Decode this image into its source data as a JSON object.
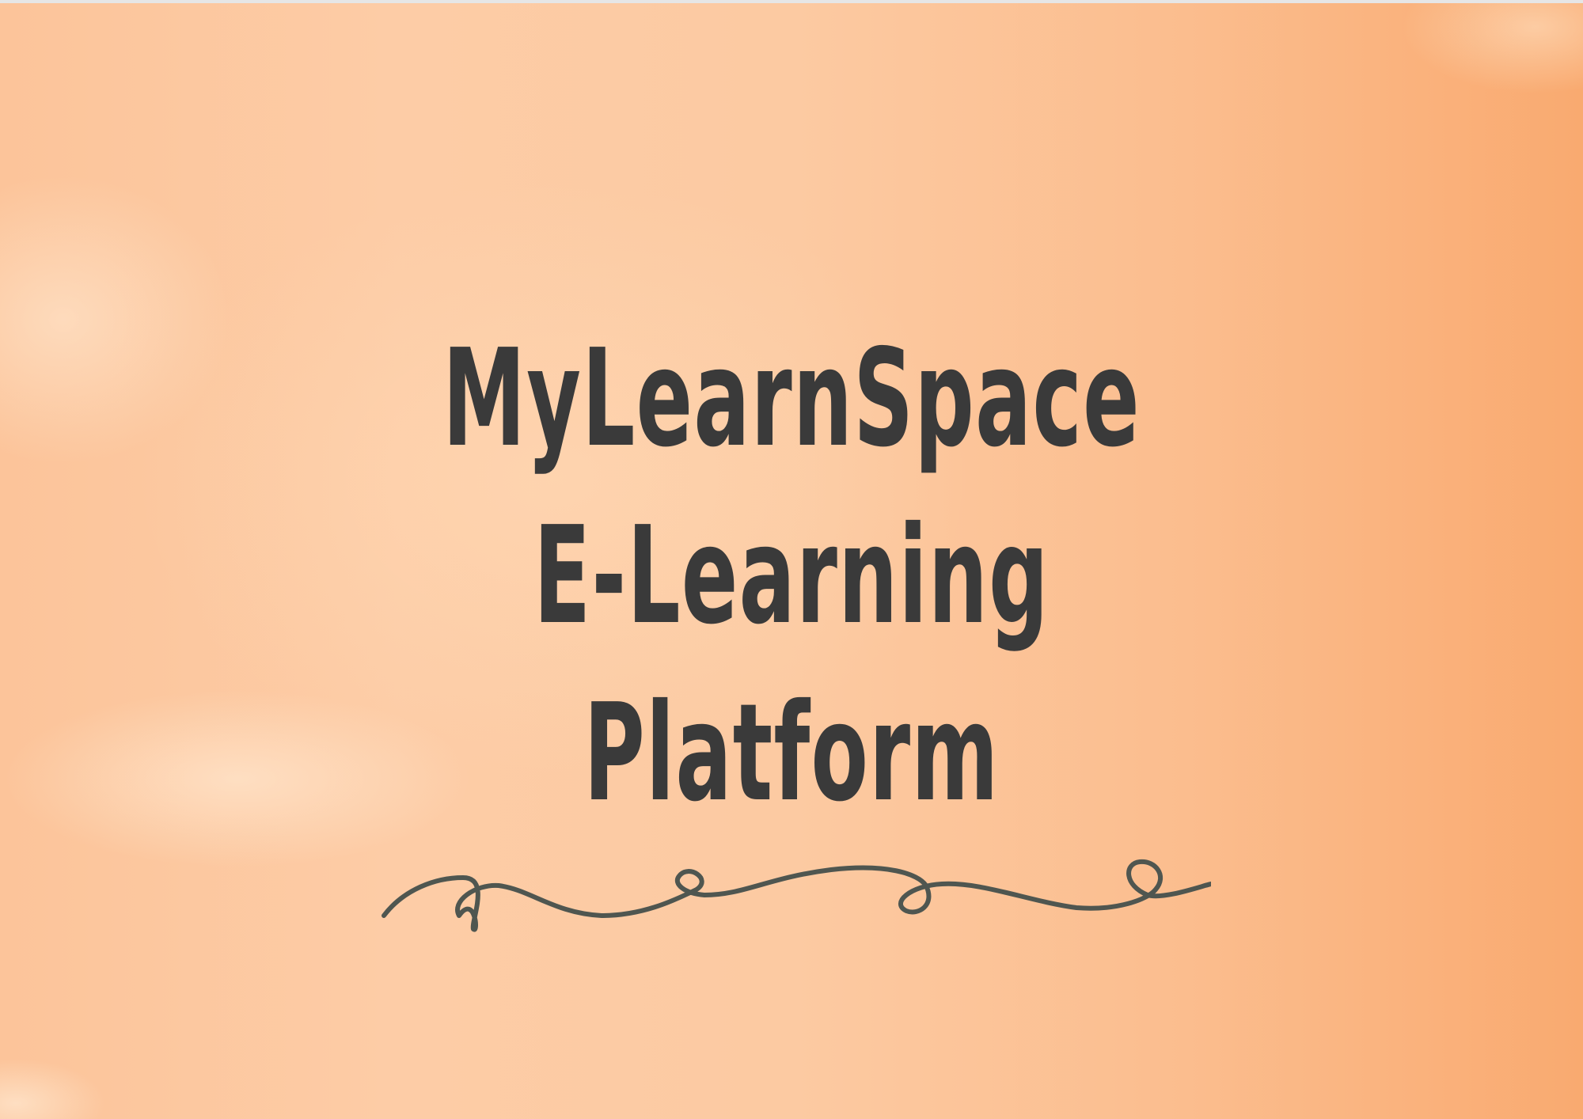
{
  "cover": {
    "title_lines": [
      "MyLearnSpace",
      "E-Learning",
      "Platform"
    ],
    "decoration": "swirl-divider",
    "colors": {
      "background_left": "#fcc49a",
      "background_right": "#f9aa70",
      "title_text": "#3a3a3a",
      "divider_stroke": "#4f5650"
    }
  }
}
